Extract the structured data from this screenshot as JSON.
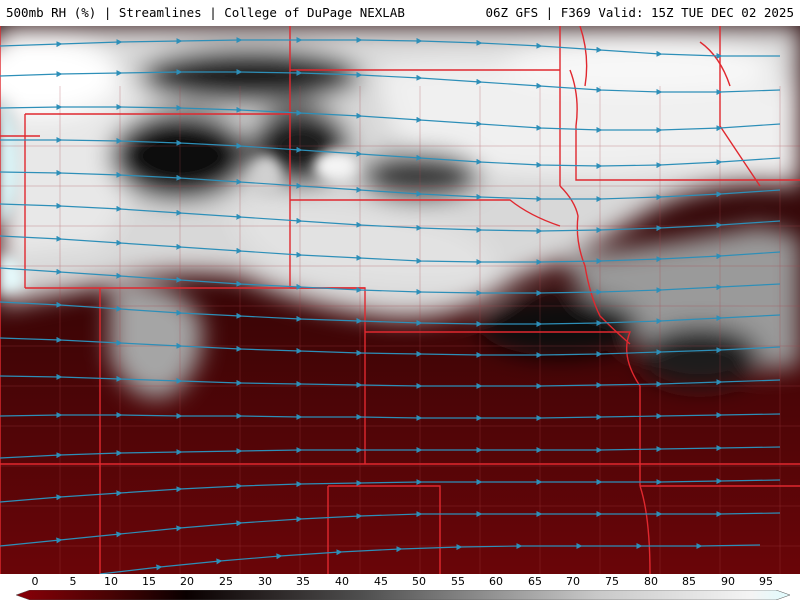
{
  "header": {
    "title_left": "500mb RH (%) | Streamlines | College of DuPage NEXLAB",
    "title_right": "06Z GFS | F369 Valid: 15Z TUE DEC 02 2025"
  },
  "map": {
    "field": "500mb RH (%)",
    "overlay": "streamlines",
    "colors": {
      "streamline": "#2d8fb8",
      "border": "#e0282f",
      "county": "#a84048",
      "dry": "#5a0a0c",
      "moist": "#f2f2f2",
      "saturated": "#dff8fb"
    }
  },
  "legend": {
    "ticks": [
      "0",
      "5",
      "10",
      "15",
      "20",
      "25",
      "30",
      "35",
      "40",
      "45",
      "50",
      "55",
      "60",
      "65",
      "70",
      "75",
      "80",
      "85",
      "90",
      "95"
    ],
    "colors": [
      "#7a0006",
      "#5c0405",
      "#3a0203",
      "#100000",
      "#1c1c1c",
      "#3a3a3a",
      "#555555",
      "#6e6e6e",
      "#888888",
      "#a2a2a2",
      "#bcbcbc",
      "#d4d4d4",
      "#ebebeb",
      "#e6fbfd"
    ]
  }
}
